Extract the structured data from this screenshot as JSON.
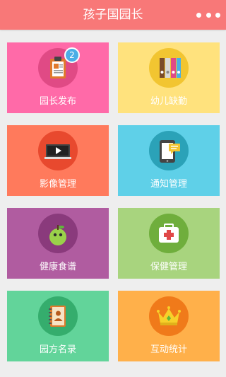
{
  "header": {
    "title": "孩子国园长",
    "more_icon": "more-dots-icon"
  },
  "tiles": [
    {
      "label": "园长发布",
      "color": "#ff6aa8",
      "icon": "clipboard-badge-icon",
      "badge": "2"
    },
    {
      "label": "幼儿缺勤",
      "color": "#ffe27d",
      "icon": "binders-icon"
    },
    {
      "label": "影像管理",
      "color": "#ff7a5c",
      "icon": "video-player-icon"
    },
    {
      "label": "通知管理",
      "color": "#5fd0e8",
      "icon": "tablet-message-icon"
    },
    {
      "label": "健康食谱",
      "color": "#b05ca0",
      "icon": "green-apple-icon"
    },
    {
      "label": "保健管理",
      "color": "#a8d47e",
      "icon": "first-aid-kit-icon"
    },
    {
      "label": "园方名录",
      "color": "#62d49a",
      "icon": "address-book-icon"
    },
    {
      "label": "互动统计",
      "color": "#ffb04a",
      "icon": "crown-icon"
    }
  ]
}
